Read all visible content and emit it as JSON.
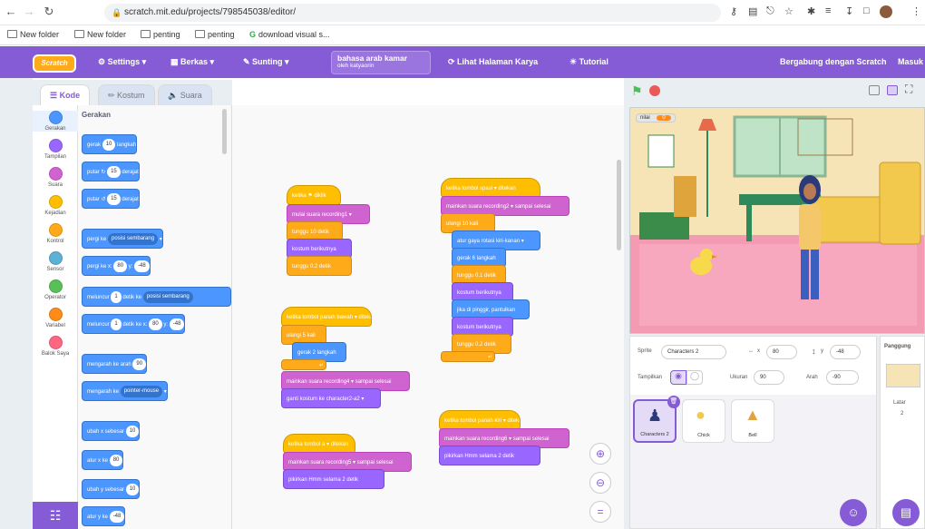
{
  "browser": {
    "url": "scratch.mit.edu/projects/798545038/editor/",
    "bookmarks": [
      "New folder",
      "New folder",
      "penting",
      "penting",
      "download visual s..."
    ]
  },
  "menu": {
    "logo": "Scratch",
    "settings": "Settings",
    "file": "Berkas",
    "edit": "Sunting",
    "project_title": "bahasa arab kamar",
    "project_author": "oleh katyaorin",
    "see_project_page": "Lihat Halaman Karya",
    "tutorial": "Tutorial",
    "join": "Bergabung dengan Scratch",
    "signin": "Masuk"
  },
  "tabs": {
    "code": "Kode",
    "costumes": "Kostum",
    "sounds": "Suara"
  },
  "categories": [
    {
      "label": "Gerakan",
      "color": "#4c97ff"
    },
    {
      "label": "Tampilan",
      "color": "#9966ff"
    },
    {
      "label": "Suara",
      "color": "#cf63cf"
    },
    {
      "label": "Kejadian",
      "color": "#ffbf00"
    },
    {
      "label": "Kontrol",
      "color": "#ffab19"
    },
    {
      "label": "Sensor",
      "color": "#5cb1d6"
    },
    {
      "label": "Operator",
      "color": "#59c059"
    },
    {
      "label": "Variabel",
      "color": "#ff8c1a"
    },
    {
      "label": "Balok Saya",
      "color": "#ff6680"
    }
  ],
  "palette": {
    "heading": "Gerakan",
    "move": {
      "a": "gerak",
      "v": "10",
      "b": "langkah"
    },
    "turn_right": {
      "a": "putar",
      "v": "15",
      "b": "derajat"
    },
    "turn_left": {
      "a": "putar",
      "v": "15",
      "b": "derajat"
    },
    "goto": {
      "a": "pergi ke",
      "opt": "posisi sembarang"
    },
    "gotoxy": {
      "a": "pergi ke x:",
      "x": "80",
      "b": "y:",
      "y": "-48"
    },
    "glide": {
      "a": "meluncur",
      "v": "1",
      "b": "detik ke",
      "opt": "posisi sembarang"
    },
    "glidexy": {
      "a": "meluncur",
      "v": "1",
      "b": "detik ke x:",
      "x": "80",
      "c": "y:",
      "y": "-48"
    },
    "point": {
      "a": "mengarah ke arah",
      "v": "90"
    },
    "pointto": {
      "a": "mengarah ke",
      "opt": "pointer-mouse"
    },
    "changex": {
      "a": "ubah x sebesar",
      "v": "10"
    },
    "setx": {
      "a": "atur x ke",
      "v": "80"
    },
    "changey": {
      "a": "ubah y sebesar",
      "v": "10"
    },
    "sety": {
      "a": "atur y ke",
      "v": "-48"
    }
  },
  "scripts": {
    "s1": {
      "hat": "ketika ⚑ diklik",
      "b1": "mulai suara  recording1 ▾",
      "b2": "tunggu 10 detik",
      "b3": "kostum berikutnya",
      "b4": "tunggu 0.2 detik"
    },
    "s2": {
      "hat": "ketika tombol  spasi ▾  ditekan",
      "b1": "mainkan suara  recording2 ▾  sampai selesai",
      "b2": "ulangi 10 kali",
      "b3": "atur gaya rotasi  kiri-kanan ▾",
      "b4": "gerak 6 langkah",
      "b5": "tunggu 0.1 detik",
      "b6": "kostum berikutnya",
      "b7": "jika di pinggir, pantulkan",
      "b8": "kostum berikutnya",
      "b9": "tunggu 0.2 detik"
    },
    "s3": {
      "hat": "ketika tombol  panah bawah ▾  ditekan",
      "b1": "ulangi 5 kali",
      "b2": "gerak 2 langkah",
      "b3": "mainkan suara  recording4 ▾  sampai selesai",
      "b4": "ganti kostum ke  character2-a2 ▾"
    },
    "s4": {
      "hat": "ketika tombol  panah kiri ▾  ditekan",
      "b1": "mainkan suara  recording6 ▾  sampai selesai",
      "b2": "pikirkan  Hmm  selama 2 detik"
    },
    "s5": {
      "hat": "ketika tombol  a ▾  ditekan",
      "b1": "mainkan suara  recording5 ▾  sampai selesai",
      "b2": "pikirkan  Hmm  selama 2 detik"
    }
  },
  "stage": {
    "variable_name": "nilai",
    "variable_value": "0"
  },
  "sprite_info": {
    "sprite_label": "Sprite",
    "sprite_name": "Characters 2",
    "x_label": "x",
    "x": "80",
    "y_label": "y",
    "y": "-48",
    "show_label": "Tampilkan",
    "size_label": "Ukuran",
    "size": "90",
    "direction_label": "Arah",
    "direction": "-90"
  },
  "sprites": [
    "Characters 2",
    "Chick",
    "Bell"
  ],
  "stage_pane": {
    "title": "Panggung",
    "backdrops_label": "Latar",
    "backdrops_count": "2"
  }
}
